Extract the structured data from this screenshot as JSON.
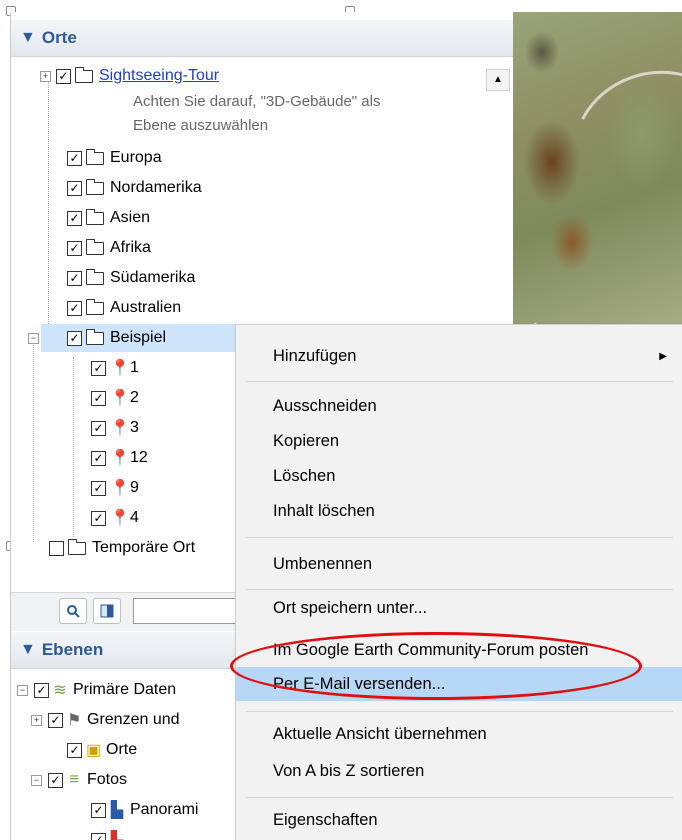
{
  "places_panel": {
    "header": "Orte",
    "items": [
      {
        "label": "Sightseeing-Tour",
        "desc_line1": "Achten Sie darauf, \"3D-Gebäude\" als",
        "desc_line2": "Ebene auszuwählen"
      },
      {
        "label": "Europa"
      },
      {
        "label": "Nordamerika"
      },
      {
        "label": "Asien"
      },
      {
        "label": "Afrika"
      },
      {
        "label": "Südamerika"
      },
      {
        "label": "Australien"
      },
      {
        "label": "Beispiel"
      },
      {
        "label": "Temporäre Ort"
      }
    ],
    "placemarks": [
      {
        "label": "1",
        "color": "#f2d622"
      },
      {
        "label": "2",
        "color": "#2f6fd6"
      },
      {
        "label": "3",
        "color": "#29b52f"
      },
      {
        "label": "12",
        "color": "#f2d622"
      },
      {
        "label": "9",
        "color": "#f2d622"
      },
      {
        "label": "4",
        "color": "#f2d622"
      }
    ]
  },
  "layers_panel": {
    "header": "Ebenen",
    "items": [
      {
        "label": "Primäre Daten"
      },
      {
        "label": "Grenzen und"
      },
      {
        "label": "Orte"
      },
      {
        "label": "Fotos"
      },
      {
        "label": "Panorami"
      }
    ]
  },
  "context_menu": {
    "items": [
      {
        "label": "Hinzufügen"
      },
      {
        "label": "Ausschneiden"
      },
      {
        "label": "Kopieren"
      },
      {
        "label": "Löschen"
      },
      {
        "label": "Inhalt löschen"
      },
      {
        "label": "Umbenennen"
      },
      {
        "label": "Ort speichern unter..."
      },
      {
        "label": "Im Google Earth Community-Forum posten"
      },
      {
        "label": "Per E-Mail versenden..."
      },
      {
        "label": "Aktuelle Ansicht übernehmen"
      },
      {
        "label": "Von A bis Z sortieren"
      },
      {
        "label": "Eigenschaften"
      }
    ]
  },
  "colors": {
    "accent": "#2c5a9a",
    "highlight": "#b6d7f5",
    "selection": "#cde4fa",
    "annotation": "#e01010"
  }
}
